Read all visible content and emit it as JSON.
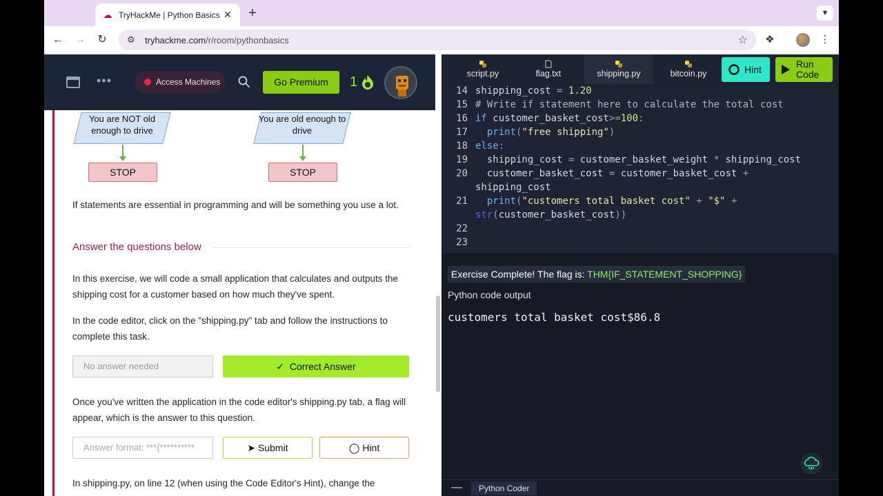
{
  "browser": {
    "tab_title": "TryHackMe | Python Basics",
    "url_domain": "tryhackme.com",
    "url_path": "/r/room/pythonbasics"
  },
  "thm_nav": {
    "access_machines": "Access Machines",
    "go_premium": "Go Premium",
    "streak_count": "1"
  },
  "flowchart": {
    "left_text": "You are NOT old enough to drive",
    "right_text": "You are old enough to drive",
    "stop_label": "STOP"
  },
  "content": {
    "if_para": "If statements are essential in programming and will be something you use a lot.",
    "questions_header": "Answer the questions below",
    "q1_text": "In this exercise, we will code a small application that calculates and outputs the shipping cost for a customer based on how much they've spent.",
    "q1_text2": "In the code editor, click on the \"shipping.py\" tab and follow the instructions to complete this task.",
    "q1_placeholder": "No answer needed",
    "q1_button": "Correct Answer",
    "q2_text": "Once you've written the application in the code editor's shipping.py tab, a flag will appear, which is the answer to this question.",
    "q2_placeholder": "Answer format: ***{**********",
    "submit": "Submit",
    "hint": "Hint",
    "q3_text": "In shipping.py, on line 12 (when using the Code Editor's Hint), change the"
  },
  "editor": {
    "tabs": [
      {
        "name": "script.py",
        "icon": "python-icon"
      },
      {
        "name": "flag.txt",
        "icon": "file-icon"
      },
      {
        "name": "shipping.py",
        "icon": "python-icon",
        "active": true
      },
      {
        "name": "bitcoin.py",
        "icon": "python-icon"
      }
    ],
    "hint_label": "Hint",
    "run_label_1": "Run",
    "run_label_2": "Code",
    "line_numbers": [
      "14",
      "15",
      "16",
      "17",
      "18",
      "19",
      "20",
      "",
      "21",
      "",
      "22",
      "23"
    ]
  },
  "output": {
    "flag_prefix": "Exercise Complete! The flag is: ",
    "flag_value": "THM{IF_STATEMENT_SHOPPING}",
    "output_label": "Python code output",
    "output_text": "customers total basket cost$86.8",
    "panel_label": "Python Coder"
  }
}
